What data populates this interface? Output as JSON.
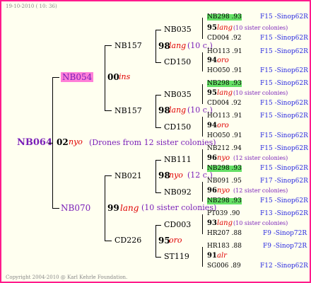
{
  "header": "19-10-2010 ( 10: 36)",
  "footer": "Copyright 2004-2010 @ Karl Kehrle Foundation.",
  "root": {
    "id": "NB064",
    "num": "02",
    "breed": "nyo",
    "note": "(Drones from 12 sister colonies)"
  },
  "gen1": [
    {
      "id": "NB054",
      "num": "00",
      "breed": "ins"
    },
    {
      "id": "NB070",
      "num": "99",
      "breed": "lang",
      "note": "(10 sister colonies)"
    }
  ],
  "gen2": [
    {
      "id": "NB157",
      "num": "98",
      "breed": "lang",
      "note": "(10 c.)"
    },
    {
      "id": "NB157",
      "num": "98",
      "breed": "lang",
      "note": "(10 c.)"
    },
    {
      "id": "NB021",
      "num": "98",
      "breed": "nyo",
      "note": "(12 c.)"
    },
    {
      "id": "CD226",
      "num": "95",
      "breed": "oro",
      "note": ""
    }
  ],
  "gen3": [
    {
      "id": "NB035",
      "num": "95",
      "breed": "lang",
      "note": "(10 sister colonies)"
    },
    {
      "id": "CD150",
      "num": "94",
      "breed": "oro",
      "note": ""
    },
    {
      "id": "NB035",
      "num": "95",
      "breed": "lang",
      "note": "(10 sister colonies)"
    },
    {
      "id": "CD150",
      "num": "94",
      "breed": "oro",
      "note": ""
    },
    {
      "id": "NB111",
      "num": "96",
      "breed": "nyo",
      "note": "(12 sister colonies)"
    },
    {
      "id": "NB092",
      "num": "96",
      "breed": "nyo",
      "note": "(12 sister colonies)"
    },
    {
      "id": "CD003",
      "num": "93",
      "breed": "lang",
      "note": "(10 sister colonies)"
    },
    {
      "id": "ST119",
      "num": "91",
      "breed": "alr",
      "note": ""
    }
  ],
  "gen4": [
    {
      "id": "NB298 .93",
      "code": "F15 -Sinop62R"
    },
    {
      "id": "CD004 .92",
      "code": "F15 -Sinop62R"
    },
    {
      "id": "HO113 .91",
      "code": "F15 -Sinop62R"
    },
    {
      "id": "HO050 .91",
      "code": "F15 -Sinop62R"
    },
    {
      "id": "NB298 .93",
      "code": "F15 -Sinop62R"
    },
    {
      "id": "CD004 .92",
      "code": "F15 -Sinop62R"
    },
    {
      "id": "HO113 .91",
      "code": "F15 -Sinop62R"
    },
    {
      "id": "HO050 .91",
      "code": "F15 -Sinop62R"
    },
    {
      "id": "NB212 .94",
      "code": "F15 -Sinop62R"
    },
    {
      "id": "NB298 .93",
      "code": "F15 -Sinop62R"
    },
    {
      "id": "NB091 .95",
      "code": "F17 -Sinop62R"
    },
    {
      "id": "NB298 .93",
      "code": "F15 -Sinop62R"
    },
    {
      "id": "PT039 .90",
      "code": "F13 -Sinop62R"
    },
    {
      "id": "HR207 .88",
      "code": "F9 -Sinop72R"
    },
    {
      "id": "HR183 .88",
      "code": "F9 -Sinop72R"
    },
    {
      "id": "SG006 .89",
      "code": "F12 -Sinop62R"
    }
  ]
}
